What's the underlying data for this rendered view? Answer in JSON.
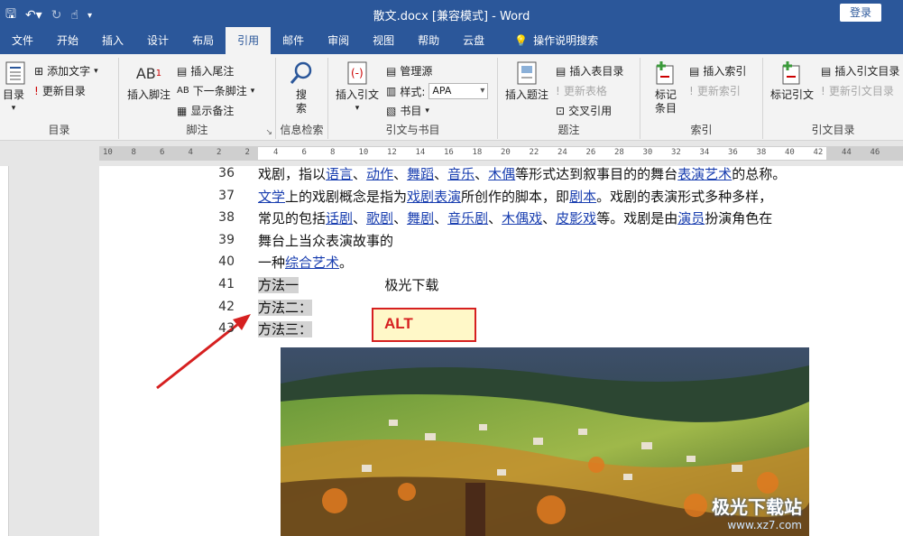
{
  "window": {
    "title": "散文.docx [兼容模式]  -  Word",
    "login": "登录"
  },
  "quick_access": [
    "save-icon",
    "undo-icon",
    "redo-icon",
    "touch-mode-icon",
    "customize-icon"
  ],
  "tabs": [
    {
      "label": "文件",
      "active": false
    },
    {
      "label": "开始",
      "active": false
    },
    {
      "label": "插入",
      "active": false
    },
    {
      "label": "设计",
      "active": false
    },
    {
      "label": "布局",
      "active": false
    },
    {
      "label": "引用",
      "active": true
    },
    {
      "label": "邮件",
      "active": false
    },
    {
      "label": "审阅",
      "active": false
    },
    {
      "label": "视图",
      "active": false
    },
    {
      "label": "帮助",
      "active": false
    },
    {
      "label": "云盘",
      "active": false
    }
  ],
  "tell_me": "操作说明搜索",
  "ribbon": {
    "toc": {
      "label": "目录",
      "btn": "目录",
      "add_text": "添加文字",
      "update": "更新目录"
    },
    "footnotes": {
      "label": "脚注",
      "insert_footnote": "插入脚注",
      "insert_endnote": "插入尾注",
      "next_footnote": "下一条脚注",
      "show_notes": "显示备注",
      "footnote_icon_text": "AB"
    },
    "research": {
      "label": "信息检索",
      "search": "搜\n索"
    },
    "citations": {
      "label": "引文与书目",
      "insert_citation": "插入引文",
      "manage_sources": "管理源",
      "style_label": "样式:",
      "style_value": "APA",
      "bibliography": "书目"
    },
    "captions": {
      "label": "题注",
      "insert_caption": "插入题注",
      "insert_table_figures": "插入表目录",
      "update_table": "更新表格",
      "cross_ref": "交叉引用"
    },
    "index": {
      "label": "索引",
      "mark_entry": "标记\n条目",
      "insert_index": "插入索引",
      "update_index": "更新索引"
    },
    "authorities": {
      "label": "引文目录",
      "mark_citation": "标记引文",
      "insert_toa": "插入引文目录",
      "update_toa": "更新引文目录"
    }
  },
  "ruler_numbers": [
    "10",
    "8",
    "6",
    "4",
    "2",
    "2",
    "4",
    "6",
    "8",
    "10",
    "12",
    "14",
    "16",
    "18",
    "20",
    "22",
    "24",
    "26",
    "28",
    "30",
    "32",
    "34",
    "36",
    "38",
    "40",
    "42",
    "44",
    "46"
  ],
  "document": {
    "lines": [
      {
        "num": "36",
        "parts": [
          {
            "t": "戏剧，指以"
          },
          {
            "t": "语言",
            "link": true
          },
          {
            "t": "、"
          },
          {
            "t": "动作",
            "link": true
          },
          {
            "t": "、"
          },
          {
            "t": "舞蹈",
            "link": true
          },
          {
            "t": "、"
          },
          {
            "t": "音乐",
            "link": true
          },
          {
            "t": "、"
          },
          {
            "t": "木偶",
            "link": true
          },
          {
            "t": "等形式达到叙事目的的舞台"
          },
          {
            "t": "表演艺术",
            "link": true
          },
          {
            "t": "的总称。"
          }
        ]
      },
      {
        "num": "37",
        "parts": [
          {
            "t": "文学",
            "link": true
          },
          {
            "t": "上的戏剧概念是指为"
          },
          {
            "t": "戏剧表演",
            "link": true
          },
          {
            "t": "所创作的脚本，即"
          },
          {
            "t": "剧本",
            "link": true
          },
          {
            "t": "。戏剧的表演形式多种多样，"
          }
        ]
      },
      {
        "num": "38",
        "parts": [
          {
            "t": "常见的包括"
          },
          {
            "t": "话剧",
            "link": true
          },
          {
            "t": "、"
          },
          {
            "t": "歌剧",
            "link": true
          },
          {
            "t": "、"
          },
          {
            "t": "舞剧",
            "link": true
          },
          {
            "t": "、"
          },
          {
            "t": "音乐剧",
            "link": true
          },
          {
            "t": "、"
          },
          {
            "t": "木偶戏",
            "link": true
          },
          {
            "t": "、"
          },
          {
            "t": "皮影戏",
            "link": true
          },
          {
            "t": "等。戏剧是由"
          },
          {
            "t": "演员",
            "link": true
          },
          {
            "t": "扮演角色在"
          }
        ]
      },
      {
        "num": "39",
        "parts": [
          {
            "t": "舞台上当众表演故事的"
          }
        ]
      },
      {
        "num": "40",
        "parts": [
          {
            "t": "一种"
          },
          {
            "t": "综合艺术",
            "link": true
          },
          {
            "t": "。"
          }
        ]
      },
      {
        "num": "41",
        "parts": [
          {
            "t": "方法一",
            "hl": true
          },
          {
            "t": "                    极光下载"
          }
        ]
      },
      {
        "num": "42",
        "parts": [
          {
            "t": "方法二：",
            "hl": true
          }
        ]
      },
      {
        "num": "43",
        "parts": [
          {
            "t": "方法三：",
            "hl": true
          }
        ]
      }
    ],
    "callout": "ALT",
    "watermark": {
      "brand": "极光下载站",
      "url": "www.xz7.com"
    }
  }
}
